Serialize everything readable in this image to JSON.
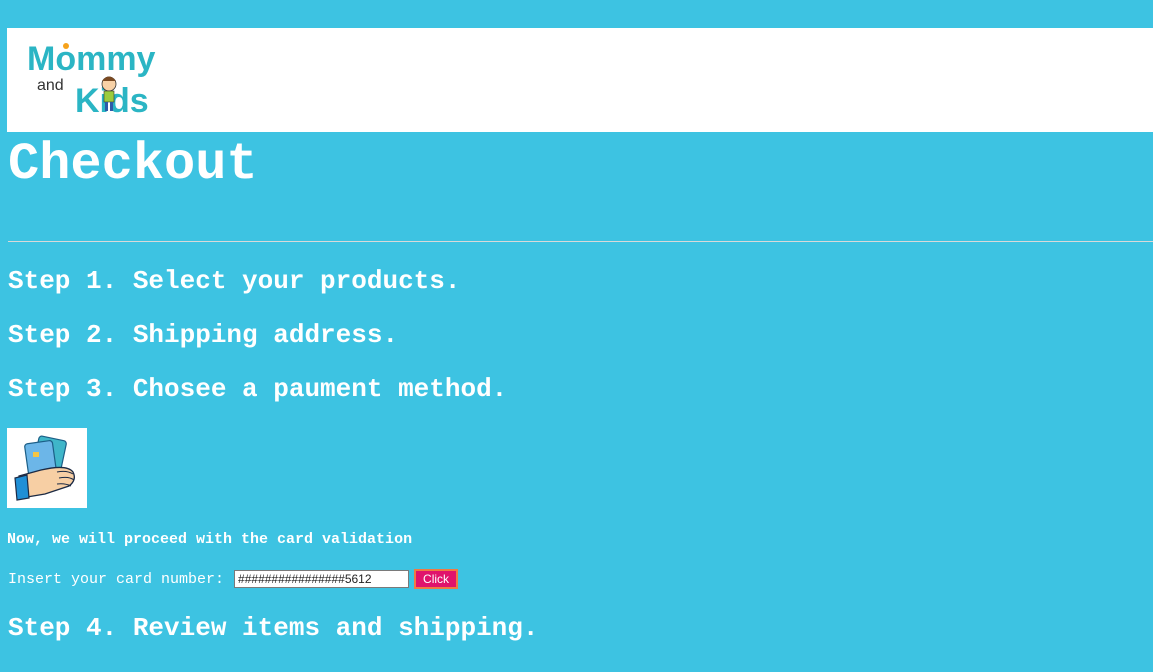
{
  "header": {
    "logo": {
      "word_top": "Mommy",
      "word_and": "and",
      "word_bottom": "Kids"
    }
  },
  "page": {
    "title": "Checkout"
  },
  "steps": {
    "step1": "Step 1. Select your products.",
    "step2": "Step 2. Shipping address.",
    "step3": "Step 3. Chosee a paument method.",
    "step4": "Step 4. Review items and shipping."
  },
  "payment": {
    "card_image_icon": "hand-holding-cards-icon",
    "validation_note": "Now, we will proceed with the card validation",
    "card_label": "Insert your card number:",
    "card_value": "################5612",
    "click_label": "Click"
  },
  "colors": {
    "background": "#3dc3e2",
    "button": "#e0136c",
    "logo_pink": "#e6177b",
    "logo_orange": "#f6a21b",
    "logo_teal": "#2bb5c4",
    "logo_green": "#9ccc3c"
  }
}
